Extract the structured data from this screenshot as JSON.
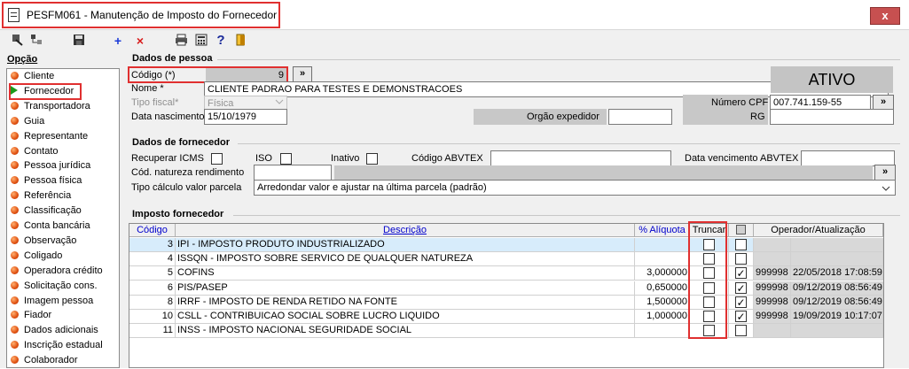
{
  "window": {
    "title": "PESFM061 - Manutenção de Imposto do Fornecedor",
    "close_label": "x"
  },
  "toolbar": {
    "icons": [
      "arrow-back-icon",
      "tree-icon",
      "save-icon",
      "add-icon",
      "delete-icon",
      "print-icon",
      "calculator-icon",
      "help-icon",
      "exit-icon"
    ],
    "add_label": "+",
    "delete_label": "×",
    "help_label": "?"
  },
  "sidebar": {
    "title": "Opção",
    "items": [
      {
        "label": "Cliente"
      },
      {
        "label": "Fornecedor",
        "selected": true
      },
      {
        "label": "Transportadora"
      },
      {
        "label": "Guia"
      },
      {
        "label": "Representante"
      },
      {
        "label": "Contato"
      },
      {
        "label": "Pessoa jurídica"
      },
      {
        "label": "Pessoa física"
      },
      {
        "label": "Referência"
      },
      {
        "label": "Classificação"
      },
      {
        "label": "Conta bancária"
      },
      {
        "label": "Observação"
      },
      {
        "label": "Coligado"
      },
      {
        "label": "Operadora crédito"
      },
      {
        "label": "Solicitação cons."
      },
      {
        "label": "Imagem pessoa"
      },
      {
        "label": "Fiador"
      },
      {
        "label": "Dados adicionais"
      },
      {
        "label": "Inscrição estadual"
      },
      {
        "label": "Colaborador"
      }
    ]
  },
  "pessoa": {
    "section_title": "Dados de pessoa",
    "codigo_label": "Código (*)",
    "codigo_value": "9",
    "lookup_label": "»",
    "nome_label": "Nome *",
    "nome_value": "CLIENTE PADRAO PARA TESTES E DEMONSTRACOES",
    "tipo_fiscal_label": "Tipo fiscal*",
    "tipo_fiscal_value": "Física",
    "data_nascimento_label": "Data nascimento",
    "data_nascimento_value": "15/10/1979",
    "orgao_label": "Orgão expedidor",
    "orgao_value": "",
    "status": "ATIVO",
    "cpf_label": "Número CPF",
    "cpf_value": "007.741.159-55",
    "rg_label": "RG",
    "rg_value": ""
  },
  "fornecedor": {
    "section_title": "Dados de fornecedor",
    "icms_label": "Recuperar ICMS",
    "iso_label": "ISO",
    "inativo_label": "Inativo",
    "abvtex_code_label": "Código ABVTEX",
    "abvtex_code_value": "",
    "abvtex_date_label": "Data vencimento ABVTEX",
    "abvtex_date_value": "",
    "natureza_label": "Cód. natureza rendimento",
    "natureza_value": "",
    "natureza_lookup_label": "»",
    "tipo_calc_label": "Tipo cálculo valor parcela",
    "tipo_calc_value": "Arredondar valor e ajustar na última parcela (padrão)"
  },
  "imposto": {
    "section_title": "Imposto fornecedor",
    "headers": {
      "codigo": "Código",
      "descricao": "Descrição",
      "aliquota": "% Alíquota",
      "truncar": "Truncar",
      "operador": "Operador/Atualização"
    },
    "rows": [
      {
        "codigo": "3",
        "descricao": "IPI - IMPOSTO PRODUTO INDUSTRIALIZADO",
        "aliquota": "",
        "truncar": false,
        "check": false,
        "operador": "",
        "atualizacao": ""
      },
      {
        "codigo": "4",
        "descricao": "ISSQN - IMPOSTO SOBRE SERVICO DE QUALQUER NATUREZA",
        "aliquota": "",
        "truncar": false,
        "check": false,
        "operador": "",
        "atualizacao": ""
      },
      {
        "codigo": "5",
        "descricao": "COFINS",
        "aliquota": "3,000000",
        "truncar": false,
        "check": true,
        "operador": "999998",
        "atualizacao": "22/05/2018 17:08:59"
      },
      {
        "codigo": "6",
        "descricao": "PIS/PASEP",
        "aliquota": "0,650000",
        "truncar": false,
        "check": true,
        "operador": "999998",
        "atualizacao": "09/12/2019 08:56:49"
      },
      {
        "codigo": "8",
        "descricao": "IRRF - IMPOSTO DE RENDA RETIDO NA FONTE",
        "aliquota": "1,500000",
        "truncar": false,
        "check": true,
        "operador": "999998",
        "atualizacao": "09/12/2019 08:56:49"
      },
      {
        "codigo": "10",
        "descricao": "CSLL - CONTRIBUICAO SOCIAL SOBRE LUCRO LIQUIDO",
        "aliquota": "1,000000",
        "truncar": false,
        "check": true,
        "operador": "999998",
        "atualizacao": "19/09/2019 10:17:07"
      },
      {
        "codigo": "11",
        "descricao": "INSS - IMPOSTO NACIONAL SEGURIDADE SOCIAL",
        "aliquota": "",
        "truncar": false,
        "check": false,
        "operador": "",
        "atualizacao": ""
      }
    ]
  },
  "colors": {
    "highlight_border": "#e03030",
    "selected_row": "#d7ecfb",
    "header_text": "#0000cc"
  }
}
